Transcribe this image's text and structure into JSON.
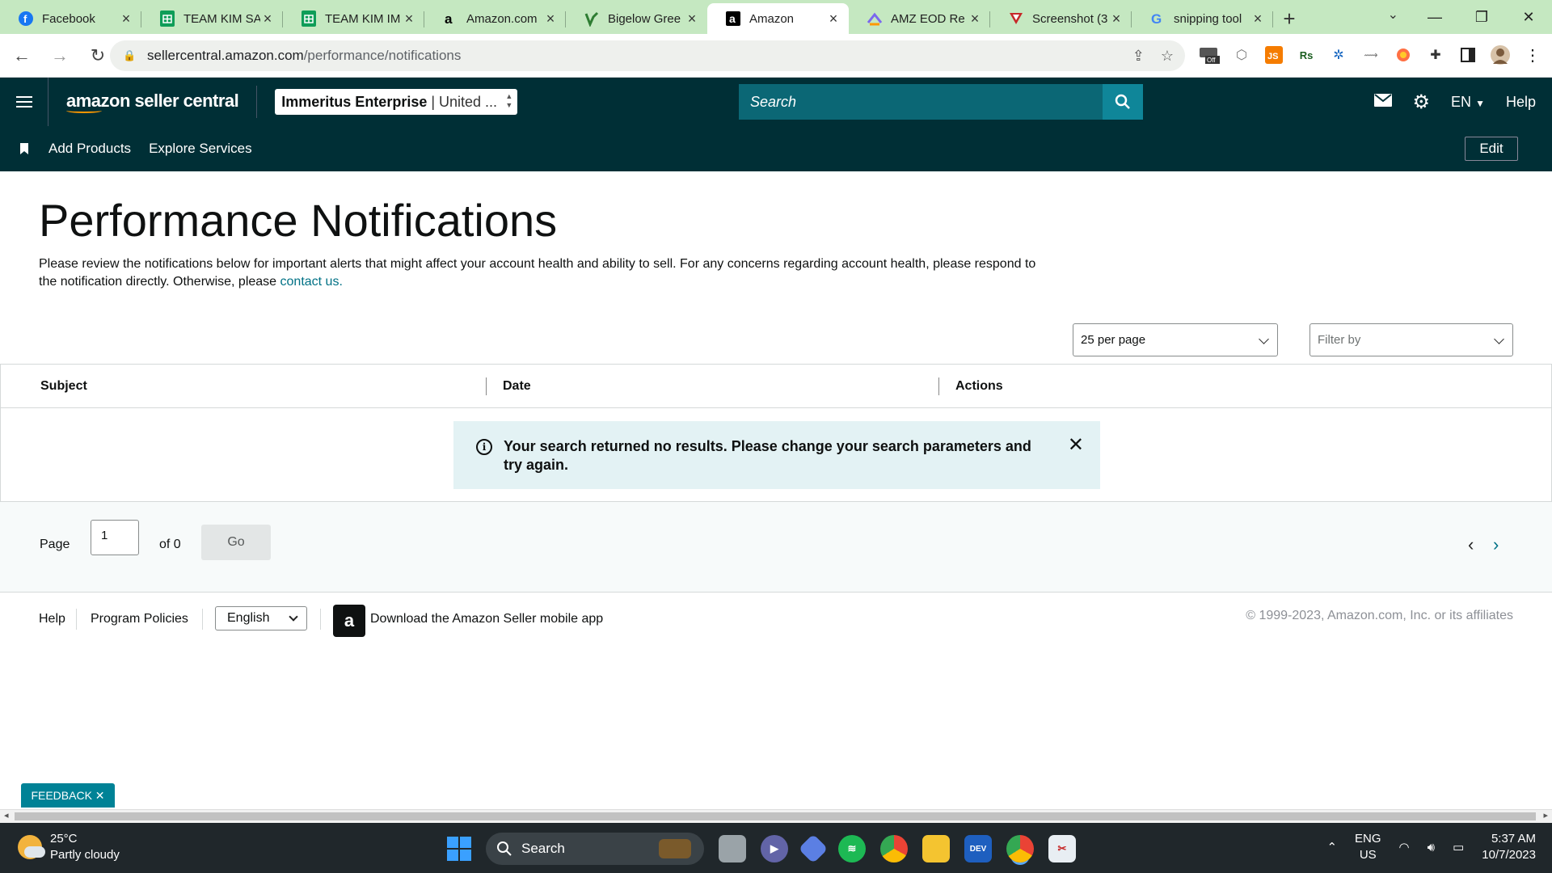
{
  "browser": {
    "tabs": [
      {
        "title": "Facebook",
        "icon": "facebook-icon",
        "color": "#1877f2"
      },
      {
        "title": "TEAM KIM SA",
        "icon": "sheets-icon",
        "color": "#0f9d58"
      },
      {
        "title": "TEAM KIM IM",
        "icon": "sheets-icon",
        "color": "#0f9d58"
      },
      {
        "title": "Amazon.com",
        "icon": "amazon-icon",
        "color": "#000000"
      },
      {
        "title": "Bigelow Gree",
        "icon": "bigelow-icon",
        "color": "#2e7d32"
      },
      {
        "title": "Amazon",
        "icon": "amazon-icon",
        "color": "#000000",
        "active": true
      },
      {
        "title": "AMZ EOD Re",
        "icon": "clickup-icon",
        "color": "#7b68ee"
      },
      {
        "title": "Screenshot (3",
        "icon": "screenshot-icon",
        "color": "#c62828"
      },
      {
        "title": "snipping tool",
        "icon": "google-icon",
        "color": "#4285f4"
      }
    ],
    "url_domain": "sellercentral.amazon.com",
    "url_path": "/performance/notifications"
  },
  "header": {
    "logo_text": "amazon seller central",
    "account_name": "Immeritus Enterprise",
    "account_region": "| United ...",
    "search_placeholder": "Search",
    "language": "EN",
    "help": "Help"
  },
  "nav": {
    "links": [
      "Add Products",
      "Explore Services"
    ],
    "edit": "Edit"
  },
  "page": {
    "title": "Performance Notifications",
    "description": "Please review the notifications below for important alerts that might affect your account health and ability to sell. For any concerns regarding account health, please respond to the notification directly. Otherwise, please ",
    "contact_link": "contact us.",
    "per_page": "25 per page",
    "filter_placeholder": "Filter by"
  },
  "table": {
    "columns": [
      "Subject",
      "Date",
      "Actions"
    ],
    "empty_message": "Your search returned no results. Please change your search parameters and try again."
  },
  "pager": {
    "page_label": "Page",
    "page_value": "1",
    "of_label": "of 0",
    "go": "Go"
  },
  "footer": {
    "help": "Help",
    "policies": "Program Policies",
    "language": "English",
    "app_text": "Download the Amazon Seller mobile app",
    "copyright": "© 1999-2023, Amazon.com, Inc. or its affiliates"
  },
  "feedback": "FEEDBACK",
  "taskbar": {
    "temp": "25°C",
    "weather": "Partly cloudy",
    "search": "Search",
    "lang1": "ENG",
    "lang2": "US",
    "time": "5:37 AM",
    "date": "10/7/2023"
  },
  "colors": {
    "header_bg": "#002f36",
    "accent": "#008296",
    "link": "#007185"
  }
}
